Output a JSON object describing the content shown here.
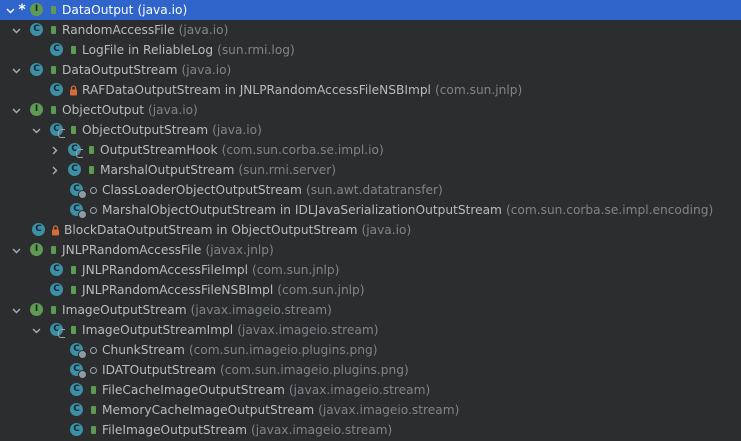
{
  "colors": {
    "background": "#2b2d2f",
    "selection": "#2f65ca",
    "text": "#bbbbbb",
    "package_text": "#7f8589",
    "class_icon": "#3d8fa6",
    "interface_icon": "#5e9a53",
    "lock_icon": "#d96a3a"
  },
  "tree": {
    "rows": [
      {
        "label": "DataOutput",
        "package": "(java.io)",
        "star": "*",
        "icon_letter": "I"
      },
      {
        "label": "RandomAccessFile",
        "package": "(java.io)",
        "icon_letter": "C"
      },
      {
        "label": "LogFile in ReliableLog",
        "package": "(sun.rmi.log)",
        "icon_letter": "C"
      },
      {
        "label": "DataOutputStream",
        "package": "(java.io)",
        "icon_letter": "C"
      },
      {
        "label": "RAFDataOutputStream in JNLPRandomAccessFileNSBImpl",
        "package": "(com.sun.jnlp)",
        "icon_letter": "C"
      },
      {
        "label": "ObjectOutput",
        "package": "(java.io)",
        "icon_letter": "I"
      },
      {
        "label": "ObjectOutputStream",
        "package": "(java.io)",
        "icon_letter": "C"
      },
      {
        "label": "OutputStreamHook",
        "package": "(com.sun.corba.se.impl.io)",
        "icon_letter": "C"
      },
      {
        "label": "MarshalOutputStream",
        "package": "(sun.rmi.server)",
        "icon_letter": "C"
      },
      {
        "label": "ClassLoaderObjectOutputStream",
        "package": "(sun.awt.datatransfer)",
        "icon_letter": "C"
      },
      {
        "label": "MarshalObjectOutputStream in IDLJavaSerializationOutputStream",
        "package": "(com.sun.corba.se.impl.encoding)",
        "icon_letter": "C"
      },
      {
        "label": "BlockDataOutputStream in ObjectOutputStream",
        "package": "(java.io)",
        "icon_letter": "C"
      },
      {
        "label": "JNLPRandomAccessFile",
        "package": "(javax.jnlp)",
        "icon_letter": "I"
      },
      {
        "label": "JNLPRandomAccessFileImpl",
        "package": "(com.sun.jnlp)",
        "icon_letter": "C"
      },
      {
        "label": "JNLPRandomAccessFileNSBImpl",
        "package": "(com.sun.jnlp)",
        "icon_letter": "C"
      },
      {
        "label": "ImageOutputStream",
        "package": "(javax.imageio.stream)",
        "icon_letter": "I"
      },
      {
        "label": "ImageOutputStreamImpl",
        "package": "(javax.imageio.stream)",
        "icon_letter": "C"
      },
      {
        "label": "ChunkStream",
        "package": "(com.sun.imageio.plugins.png)",
        "icon_letter": "C"
      },
      {
        "label": "IDATOutputStream",
        "package": "(com.sun.imageio.plugins.png)",
        "icon_letter": "C"
      },
      {
        "label": "FileCacheImageOutputStream",
        "package": "(javax.imageio.stream)",
        "icon_letter": "C"
      },
      {
        "label": "MemoryCacheImageOutputStream",
        "package": "(javax.imageio.stream)",
        "icon_letter": "C"
      },
      {
        "label": "FileImageOutputStream",
        "package": "(javax.imageio.stream)",
        "icon_letter": "C"
      }
    ]
  }
}
